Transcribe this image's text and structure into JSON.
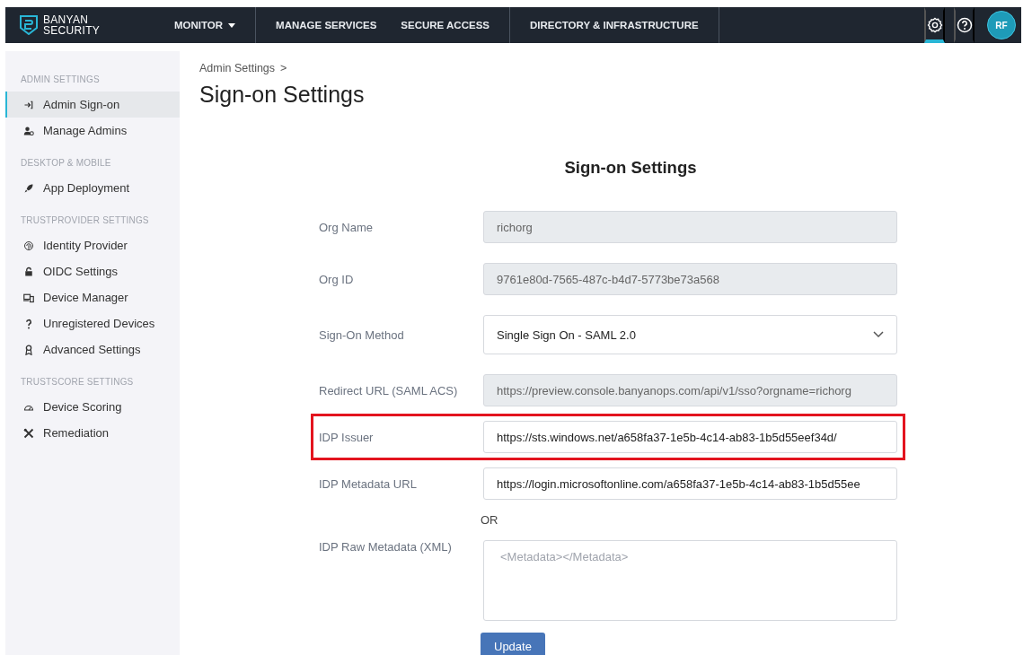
{
  "header": {
    "logo": {
      "line1": "BANYAN",
      "line2": "SECURITY"
    },
    "nav_groups": [
      [
        {
          "label": "MONITOR",
          "has_menu": true
        }
      ],
      [
        {
          "label": "MANAGE SERVICES",
          "has_menu": false
        },
        {
          "label": "SECURE ACCESS",
          "has_menu": false
        }
      ],
      [
        {
          "label": "DIRECTORY & INFRASTRUCTURE",
          "has_menu": false
        }
      ]
    ],
    "tools": [
      {
        "kind": "settings",
        "selected": true
      },
      {
        "kind": "help",
        "selected": false
      }
    ],
    "avatar": "RF"
  },
  "sidebar": {
    "sections": [
      {
        "title": "ADMIN SETTINGS",
        "items": [
          {
            "label": "Admin Sign-on",
            "selected": true
          },
          {
            "label": "Manage Admins",
            "selected": false
          }
        ]
      },
      {
        "title": "DESKTOP & MOBILE",
        "items": [
          {
            "label": "App Deployment",
            "selected": false
          }
        ]
      },
      {
        "title": "TRUSTPROVIDER SETTINGS",
        "items": [
          {
            "label": "Identity Provider",
            "selected": false
          },
          {
            "label": "OIDC Settings",
            "selected": false
          },
          {
            "label": "Device Manager",
            "selected": false
          },
          {
            "label": "Unregistered Devices",
            "selected": false
          },
          {
            "label": "Advanced Settings",
            "selected": false
          }
        ]
      },
      {
        "title": "TRUSTSCORE SETTINGS",
        "items": [
          {
            "label": "Device Scoring",
            "selected": false
          },
          {
            "label": "Remediation",
            "selected": false
          }
        ]
      }
    ]
  },
  "breadcrumb": {
    "label": "Admin Settings",
    "separator": ">"
  },
  "page_title": "Sign-on Settings",
  "form": {
    "title": "Sign-on Settings",
    "rows": [
      {
        "kind": "readonly",
        "label": "Org Name",
        "value": "richorg",
        "highlighted": false
      },
      {
        "kind": "readonly",
        "label": "Org ID",
        "value": "9761e80d-7565-487c-b4d7-5773be73a568",
        "highlighted": false
      },
      {
        "kind": "select",
        "label": "Sign-On Method",
        "value": "Single Sign On - SAML 2.0",
        "highlighted": false
      },
      {
        "kind": "readonly",
        "label": "Redirect URL (SAML ACS)",
        "value": "https://preview.console.banyanops.com/api/v1/sso?orgname=richorg",
        "highlighted": false
      },
      {
        "kind": "input",
        "label": "IDP Issuer",
        "value": "https://sts.windows.net/a658fa37-1e5b-4c14-ab83-1b5d55eef34d/",
        "highlighted": true
      },
      {
        "kind": "input",
        "label": "IDP Metadata URL",
        "value": "https://login.microsoftonline.com/a658fa37-1e5b-4c14-ab83-1b5d55ee",
        "highlighted": false
      },
      {
        "kind": "separator",
        "label": "OR"
      },
      {
        "kind": "textarea",
        "label": "IDP Raw Metadata (XML)",
        "placeholder": "<Metadata></Metadata>",
        "highlighted": false
      }
    ],
    "submit": "Update"
  }
}
